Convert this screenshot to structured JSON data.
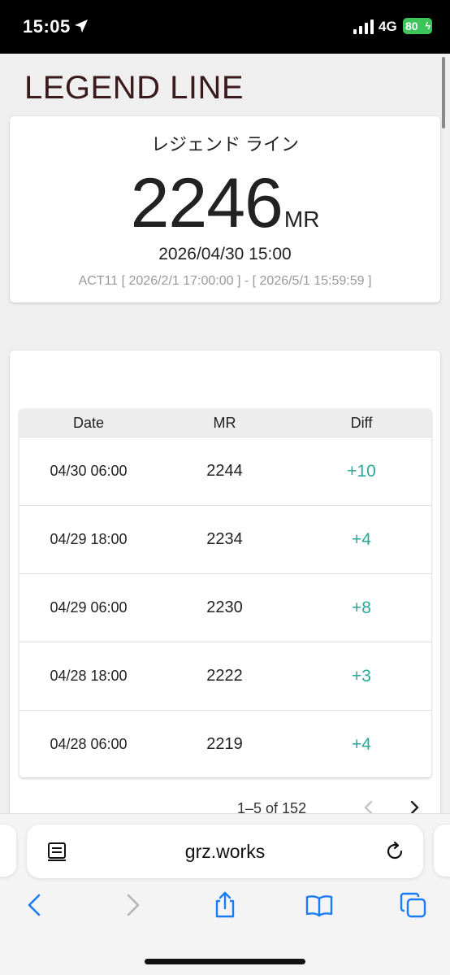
{
  "status": {
    "time": "15:05",
    "network": "4G",
    "battery": "80"
  },
  "app": {
    "title": "LEGEND LINE"
  },
  "summary": {
    "name": "レジェンド ライン",
    "mr_value": "2246",
    "mr_unit": "MR",
    "datetime": "2026/04/30 15:00",
    "period": "ACT11 [ 2026/2/1 17:00:00 ] - [ 2026/5/1 15:59:59 ]"
  },
  "table": {
    "headers": {
      "date": "Date",
      "mr": "MR",
      "diff": "Diff"
    },
    "rows": [
      {
        "date": "04/30 06:00",
        "mr": "2244",
        "diff": "+10"
      },
      {
        "date": "04/29 18:00",
        "mr": "2234",
        "diff": "+4"
      },
      {
        "date": "04/29 06:00",
        "mr": "2230",
        "diff": "+8"
      },
      {
        "date": "04/28 18:00",
        "mr": "2222",
        "diff": "+3"
      },
      {
        "date": "04/28 06:00",
        "mr": "2219",
        "diff": "+4"
      }
    ],
    "pagination": {
      "text": "1–5 of 152",
      "prev": "‹",
      "next": "›"
    }
  },
  "browser": {
    "url": "grz.works"
  },
  "colors": {
    "diff_positive": "#2aa99a",
    "title": "#3a1a1a",
    "battery": "#3cc55a",
    "ios_blue": "#1a7cf5"
  },
  "icons": [
    "location-arrow-icon",
    "signal-icon",
    "reader-icon",
    "reload-icon",
    "back-icon",
    "forward-icon",
    "share-icon",
    "bookmarks-icon",
    "tabs-icon"
  ]
}
